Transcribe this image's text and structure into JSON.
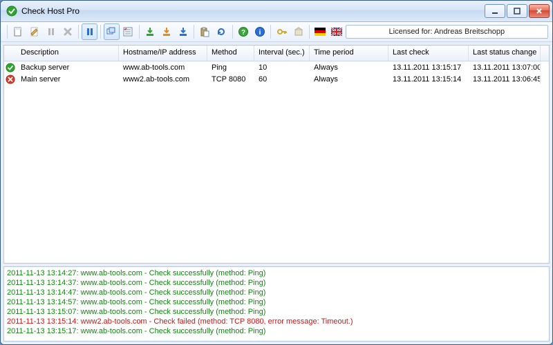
{
  "window": {
    "title": "Check Host Pro"
  },
  "toolbar": {
    "license_text": "Licensed for: Andreas Breitschopp"
  },
  "columns": {
    "description": "Description",
    "hostname": "Hostname/IP address",
    "method": "Method",
    "interval": "Interval (sec.)",
    "period": "Time period",
    "lastcheck": "Last check",
    "lastchange": "Last status change"
  },
  "rows": [
    {
      "status": "ok",
      "description": "Backup server",
      "hostname": "www.ab-tools.com",
      "method": "Ping",
      "interval": "10",
      "period": "Always",
      "lastcheck": "13.11.2011 13:15:17",
      "lastchange": "13.11.2011 13:07:00"
    },
    {
      "status": "err",
      "description": "Main server",
      "hostname": "www2.ab-tools.com",
      "method": "TCP 8080",
      "interval": "60",
      "period": "Always",
      "lastcheck": "13.11.2011 13:15:14",
      "lastchange": "13.11.2011 13:06:45"
    }
  ],
  "log": [
    {
      "level": "ok",
      "text": "2011-11-13 13:14:27: www.ab-tools.com - Check successfully (method: Ping)"
    },
    {
      "level": "ok",
      "text": "2011-11-13 13:14:37: www.ab-tools.com - Check successfully (method: Ping)"
    },
    {
      "level": "ok",
      "text": "2011-11-13 13:14:47: www.ab-tools.com - Check successfully (method: Ping)"
    },
    {
      "level": "ok",
      "text": "2011-11-13 13:14:57: www.ab-tools.com - Check successfully (method: Ping)"
    },
    {
      "level": "ok",
      "text": "2011-11-13 13:15:07: www.ab-tools.com - Check successfully (method: Ping)"
    },
    {
      "level": "err",
      "text": "2011-11-13 13:15:14: www2.ab-tools.com - Check failed (method: TCP 8080, error message: Timeout.)"
    },
    {
      "level": "ok",
      "text": "2011-11-13 13:15:17: www.ab-tools.com - Check successfully (method: Ping)"
    }
  ],
  "icons": {
    "app": "check-circle",
    "toolbar": [
      "new-doc",
      "edit-doc",
      "pause-gray",
      "delete-gray",
      "pause-blue",
      "window-copy",
      "checklist",
      "download-green",
      "download-orange",
      "download-blue",
      "paste",
      "refresh",
      "help",
      "info",
      "key",
      "box",
      "flag-de",
      "flag-gb"
    ]
  }
}
